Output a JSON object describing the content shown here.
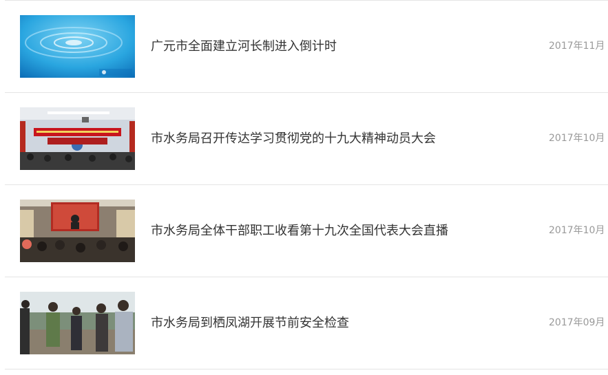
{
  "news": {
    "items": [
      {
        "title": "广元市全面建立河长制进入倒计时",
        "date": "2017年11月",
        "thumb_icon": "water-drop-photo"
      },
      {
        "title": "市水务局召开传达学习贯彻党的十九大精神动员大会",
        "date": "2017年10月",
        "thumb_icon": "meeting-hall-photo"
      },
      {
        "title": "市水务局全体干部职工收看第十九次全国代表大会直播",
        "date": "2017年10月",
        "thumb_icon": "broadcast-viewing-photo"
      },
      {
        "title": "市水务局到栖凤湖开展节前安全检查",
        "date": "2017年09月",
        "thumb_icon": "inspection-group-photo"
      }
    ]
  }
}
